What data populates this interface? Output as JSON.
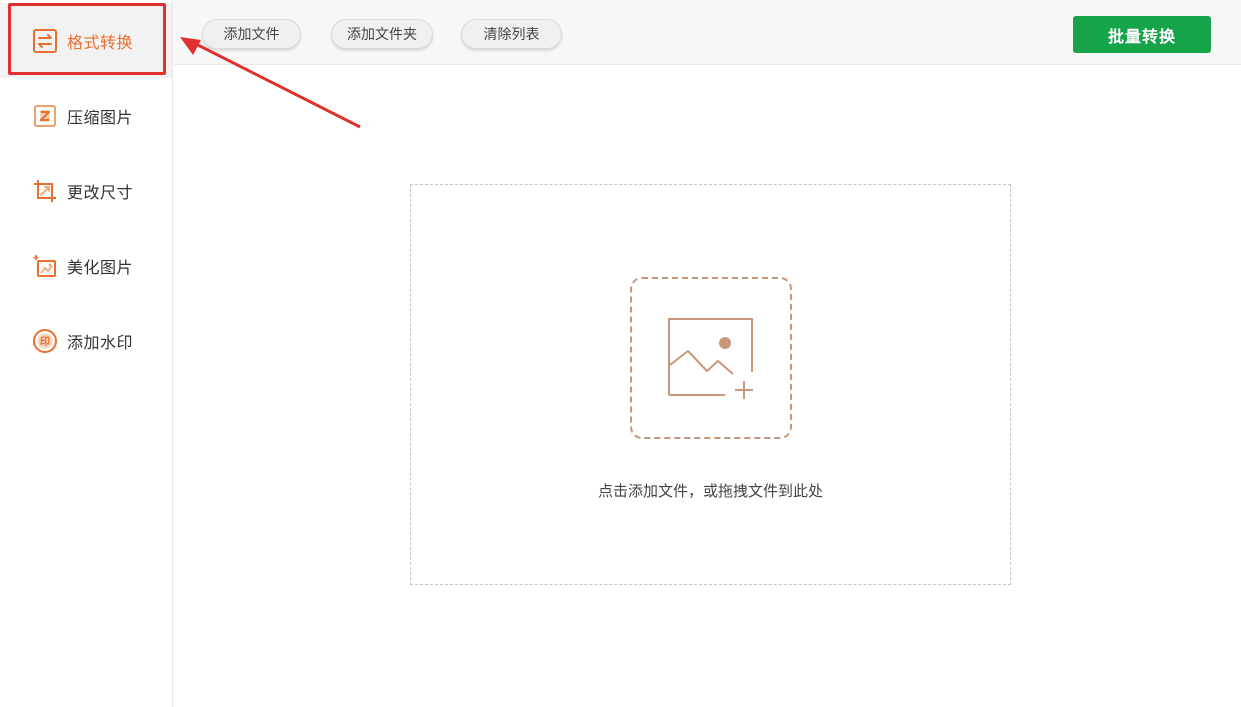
{
  "sidebar": {
    "items": [
      {
        "label": "格式转换",
        "icon": "format-convert-icon",
        "active": true
      },
      {
        "label": "压缩图片",
        "icon": "compress-image-icon",
        "active": false
      },
      {
        "label": "更改尺寸",
        "icon": "resize-icon",
        "active": false
      },
      {
        "label": "美化图片",
        "icon": "beautify-image-icon",
        "active": false
      },
      {
        "label": "添加水印",
        "icon": "watermark-icon",
        "active": false
      }
    ]
  },
  "toolbar": {
    "add_file": "添加文件",
    "add_folder": "添加文件夹",
    "clear_list": "清除列表",
    "batch_convert": "批量转换"
  },
  "dropzone": {
    "hint": "点击添加文件，或拖拽文件到此处",
    "icon": "add-image-icon"
  },
  "colors": {
    "accent": "#e86f2d",
    "primary_green": "#17a34a",
    "annotation_red": "#e03030",
    "icon_brown": "#c9967a"
  }
}
